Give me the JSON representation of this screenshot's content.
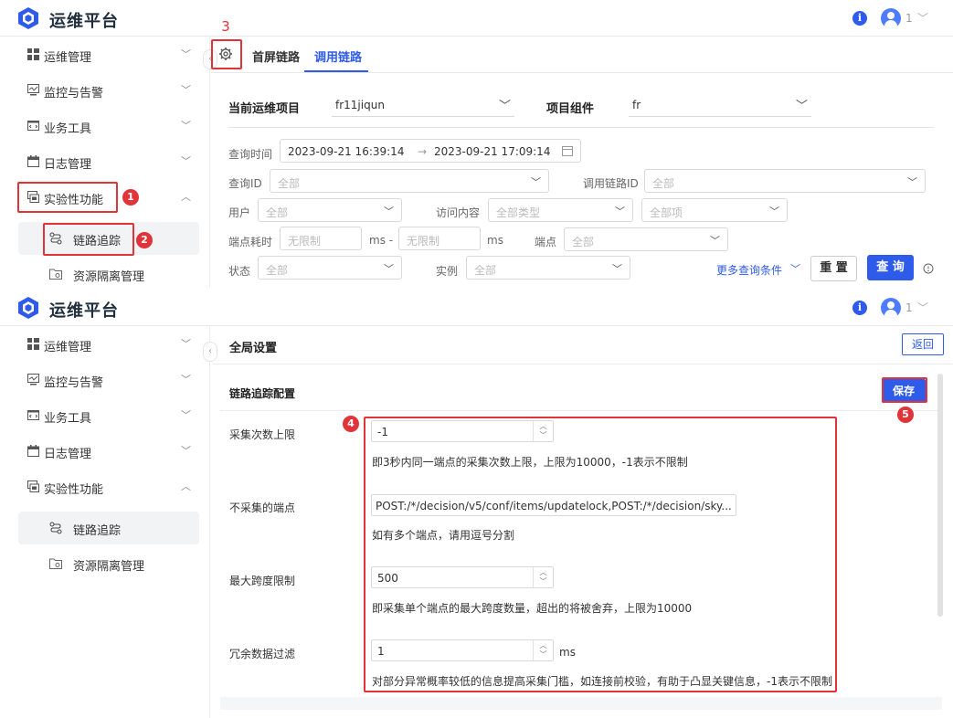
{
  "app": {
    "title": "运维平台",
    "user_label": "1"
  },
  "sidebar": {
    "items": [
      {
        "label": "运维管理"
      },
      {
        "label": "监控与告警"
      },
      {
        "label": "业务工具"
      },
      {
        "label": "日志管理"
      },
      {
        "label": "实验性功能"
      }
    ],
    "subitems": [
      {
        "label": "链路追踪"
      },
      {
        "label": "资源隔离管理"
      }
    ]
  },
  "annotations": [
    "1",
    "2",
    "3",
    "4",
    "5"
  ],
  "tabs": [
    {
      "label": "首屏链路"
    },
    {
      "label": "调用链路"
    }
  ],
  "filters": {
    "project_label": "当前运维项目",
    "project_value": "fr11jiqun",
    "component_label": "项目组件",
    "component_value": "fr",
    "query_time_label": "查询时间",
    "time_start": "2023-09-21 16:39:14",
    "time_arrow": "→",
    "time_end": "2023-09-21 17:09:14",
    "query_id_label": "查询ID",
    "query_id_placeholder": "全部",
    "chain_id_label": "调用链路ID",
    "chain_id_placeholder": "全部",
    "user_label": "用户",
    "user_placeholder": "全部",
    "access_label": "访问内容",
    "access_type_placeholder": "全部类型",
    "access_item_placeholder": "全部项",
    "duration_label": "端点耗时",
    "duration_min_placeholder": "无限制",
    "duration_sep": "ms -",
    "duration_max_placeholder": "无限制",
    "duration_unit": "ms",
    "endpoint_label": "端点",
    "endpoint_placeholder": "全部",
    "status_label": "状态",
    "status_placeholder": "全部",
    "instance_label": "实例",
    "instance_placeholder": "全部",
    "more_conditions": "更多查询条件",
    "reset_button": "重 置",
    "query_button": "查 询"
  },
  "settings": {
    "header_title": "全局设置",
    "back_button": "返回",
    "section_title": "链路追踪配置",
    "save_button": "保存",
    "fields": [
      {
        "label": "采集次数上限",
        "value": "-1",
        "hint": "即3秒内同一端点的采集次数上限，上限为10000，-1表示不限制"
      },
      {
        "label": "不采集的端点",
        "value": "POST:/*/decision/v5/conf/items/updatelock,POST:/*/decision/sky...",
        "hint": "如有多个端点，请用逗号分割"
      },
      {
        "label": "最大跨度限制",
        "value": "500",
        "hint": "即采集单个端点的最大跨度数量，超出的将被舍弃，上限为10000"
      },
      {
        "label": "冗余数据过滤",
        "value": "1",
        "unit": "ms",
        "hint": "对部分异常概率较低的信息提高采集门槛，如连接前校验，有助于凸显关键信息，-1表示不限制"
      }
    ]
  },
  "colors": {
    "accent": "#2f5bea",
    "highlight": "#e0343a"
  }
}
